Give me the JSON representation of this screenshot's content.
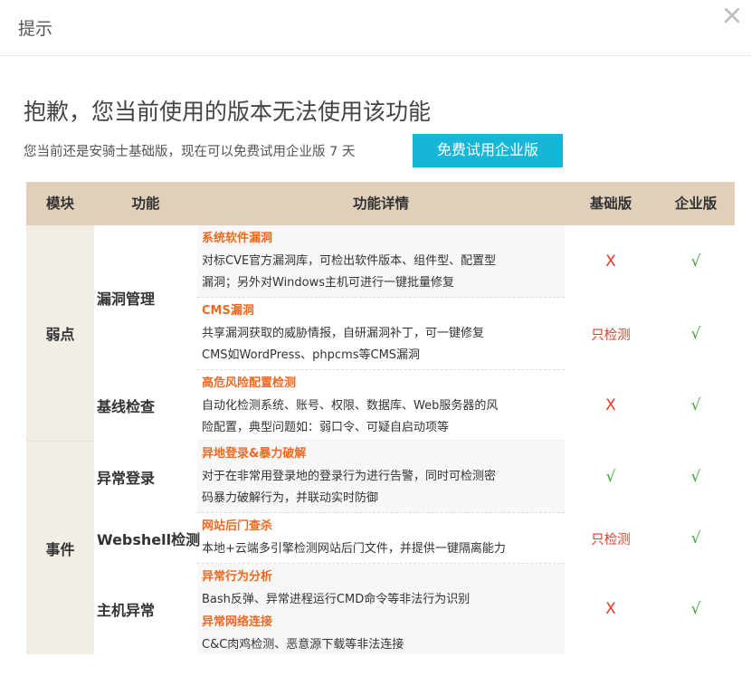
{
  "dialog": {
    "title": "提示",
    "headline": "抱歉，您当前使用的版本无法使用该功能",
    "subline": "您当前还是安骑士基础版，现在可以免费试用企业版 7 天",
    "trial_button": "免费试用企业版"
  },
  "table": {
    "headers": [
      "模块",
      "功能",
      "功能详情",
      "基础版",
      "企业版"
    ],
    "modules": [
      "弱点",
      "事件"
    ],
    "rows": [
      {
        "feature": "漏洞管理",
        "details": [
          {
            "title": "系统软件漏洞",
            "lines": [
              "对标CVE官方漏洞库，可检出软件版本、组件型、配置型",
              "漏洞；另外对Windows主机可进行一键批量修复"
            ]
          },
          {
            "title": "CMS漏洞",
            "lines": [
              "共享漏洞获取的威胁情报，自研漏洞补丁，可一键修复",
              "CMS如WordPress、phpcms等CMS漏洞"
            ]
          }
        ],
        "basic": [
          "X",
          "只检测"
        ],
        "enterprise": [
          "√",
          "√"
        ]
      },
      {
        "feature": "基线检查",
        "details": [
          {
            "title": "高危风险配置检测",
            "lines": [
              "自动化检测系统、账号、权限、数据库、Web服务器的风",
              "险配置，典型问题如：弱口令、可疑自启动项等"
            ]
          }
        ],
        "basic": [
          "X"
        ],
        "enterprise": [
          "√"
        ]
      },
      {
        "feature": "异常登录",
        "details": [
          {
            "title": "异地登录&暴力破解",
            "lines": [
              "对于在非常用登录地的登录行为进行告警，同时可检测密",
              "码暴力破解行为，并联动实时防御"
            ]
          }
        ],
        "basic": [
          "√"
        ],
        "enterprise": [
          "√"
        ]
      },
      {
        "feature": "Webshell检测",
        "details": [
          {
            "title": "网站后门查杀",
            "lines": [
              "本地+云端多引擎检测网站后门文件，并提供一键隔离能力"
            ]
          }
        ],
        "basic": [
          "只检测"
        ],
        "enterprise": [
          "√"
        ]
      },
      {
        "feature": "主机异常",
        "details": [
          {
            "title": "异常行为分析",
            "lines": [
              "Bash反弹、异常进程运行CMD命令等非法行为识别"
            ]
          },
          {
            "title": "异常网络连接",
            "lines": [
              "C&C肉鸡检测、恶意源下载等非法连接"
            ]
          }
        ],
        "basic": [
          "X"
        ],
        "enterprise": [
          "√"
        ]
      }
    ]
  },
  "icons": {
    "close": "close-icon"
  },
  "colors": {
    "accent_button": "#17b6d6",
    "header_bg": "#e0d0b9",
    "detail_title": "#ee6a22",
    "cross": "#e03b2b",
    "check": "#3aa93a"
  }
}
